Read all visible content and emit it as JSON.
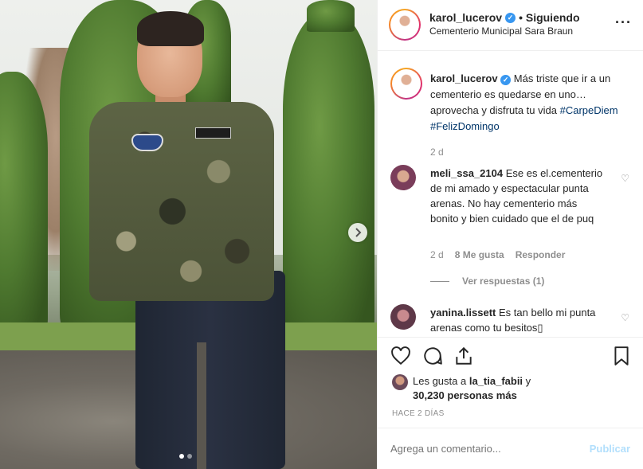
{
  "post": {
    "username": "karol_lucerov",
    "follow_label": "• Siguiendo",
    "location": "Cementerio Municipal Sara Braun",
    "more_label": "···"
  },
  "caption": {
    "username": "karol_lucerov",
    "text": "Más triste que ir a un cementerio es quedarse en uno… aprovecha y disfruta tu vida",
    "hashtags": [
      "#CarpeDiem",
      "#FelizDomingo"
    ],
    "time": "2 d"
  },
  "comments": [
    {
      "username": "meli_ssa_2104",
      "text": "Ese es el.cementerio de mi amado y espectacular punta arenas. No hay cementerio más bonito y bien cuidado que el de puq",
      "time": "2 d",
      "likes": "8 Me gusta",
      "reply": "Responder",
      "view_replies": "Ver respuestas (1)"
    },
    {
      "username": "yanina.lissett",
      "text": "Es tan bello mi punta arenas como tu besitos▯"
    }
  ],
  "likes": {
    "prefix": "Les gusta a",
    "user": "la_tia_fabii",
    "suffix": "y",
    "others": "30,230 personas más"
  },
  "ago": "HACE 2 DÍAS",
  "add_comment": {
    "placeholder": "Agrega un comentario...",
    "post_label": "Publicar"
  },
  "colors": {
    "link": "#003569",
    "verified": "#3897f0",
    "muted": "#8e8e8e",
    "post_disabled": "#b2dffc"
  }
}
